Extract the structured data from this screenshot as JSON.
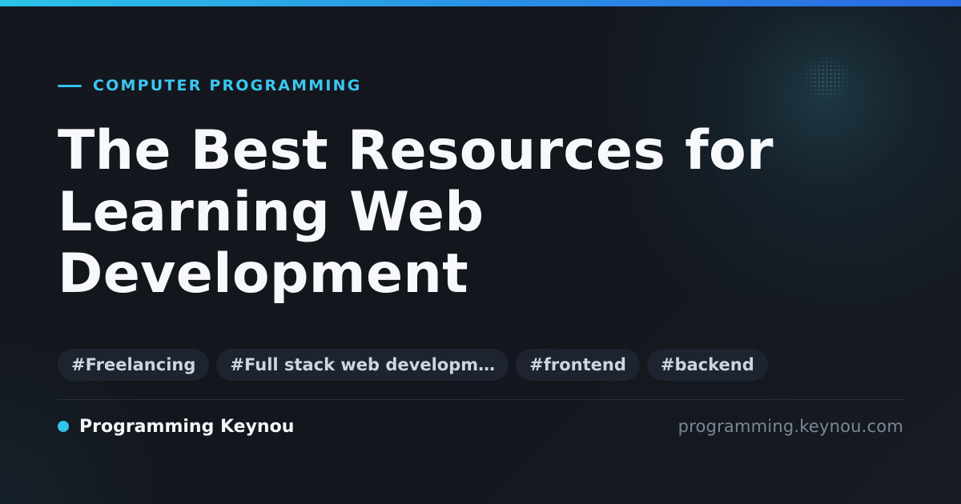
{
  "category": "COMPUTER PROGRAMMING",
  "title_lines": [
    "The Best Resources for",
    "Learning Web",
    "Development"
  ],
  "tags": [
    {
      "label": "#Freelancing"
    },
    {
      "label": "#Full stack web developm…"
    },
    {
      "label": "#frontend"
    },
    {
      "label": "#backend"
    }
  ],
  "brand": {
    "name": "Programming Keynou"
  },
  "site": {
    "url": "programming.keynou.com"
  },
  "colors": {
    "accent": "#33c3ec",
    "background": "#13161d",
    "tag_background": "#1d2430",
    "title": "#f6f8fb",
    "muted": "#7d8794"
  }
}
